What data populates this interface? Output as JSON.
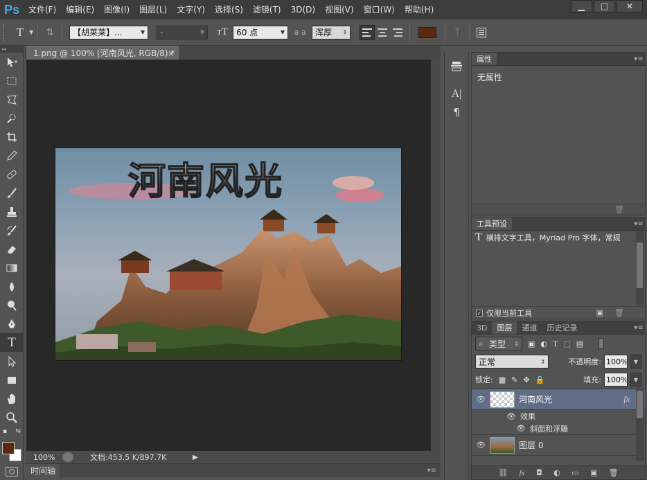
{
  "app": {
    "logo": "Ps"
  },
  "menu": [
    "文件(F)",
    "编辑(E)",
    "图像(I)",
    "图层(L)",
    "文字(Y)",
    "选择(S)",
    "滤镜(T)",
    "3D(D)",
    "视图(V)",
    "窗口(W)",
    "帮助(H)"
  ],
  "window_controls": {
    "minimize": "▁",
    "restore": "□",
    "close": "✕"
  },
  "options": {
    "tool_letter": "T",
    "font_family": "【胡莱莱】...",
    "font_style": "-",
    "font_size": "60 点",
    "aa_label": "a a",
    "aa_mode": "浑厚",
    "color_hex": "#5a2a0e"
  },
  "document": {
    "tab_title": "1.png @ 100% (河南风光, RGB/8) *",
    "tab_close": "×",
    "canvas_text": "河南风光",
    "zoom": "100%",
    "doc_size": "文档:453.5 K/897.7K"
  },
  "timeline": {
    "label": "时间轴"
  },
  "colors": {
    "foreground": "#5a2a0e",
    "background": "#ffffff"
  },
  "properties": {
    "tab": "属性",
    "body": "无属性"
  },
  "tool_presets": {
    "tab": "工具预设",
    "item": "横排文字工具，Myriad Pro 字体，常规",
    "current_only": "仅限当前工具"
  },
  "layers": {
    "tabs": [
      "3D",
      "图层",
      "通道",
      "历史记录"
    ],
    "filter": "类型",
    "blend_mode": "正常",
    "opacity_label": "不透明度:",
    "opacity": "100%",
    "lock_label": "锁定:",
    "fill_label": "填充:",
    "fill": "100%",
    "items": [
      {
        "name": "河南风光",
        "fx": "fx",
        "effects": "效果",
        "sub": "斜面和浮雕"
      },
      {
        "name": "图层 0"
      }
    ],
    "footer": [
      "⛓",
      "fx",
      "◘",
      "◐",
      "▭",
      "▣",
      "🗑"
    ]
  }
}
